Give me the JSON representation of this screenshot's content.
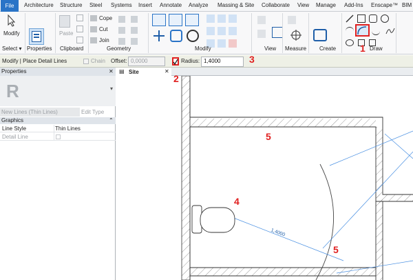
{
  "tabs": [
    "File",
    "Architecture",
    "Structure",
    "Steel",
    "Systems",
    "Insert",
    "Annotate",
    "Analyze",
    "Massing & Site",
    "Collaborate",
    "View",
    "Manage",
    "Add-Ins",
    "Enscape™",
    "BIM"
  ],
  "ribbon": {
    "modify_label": "Modify",
    "paste_label": "Paste",
    "cope_label": "Cope",
    "cut_label": "Cut",
    "join_label": "Join",
    "panels": [
      "Select ▾",
      "Properties",
      "Clipboard",
      "Geometry",
      "Modify",
      "View",
      "Measure",
      "Create",
      "Draw"
    ]
  },
  "options_bar": {
    "context_title": "Modify | Place Detail Lines",
    "chain_label": "Chain",
    "offset_label": "Offset:",
    "offset_value": "0,0000",
    "radius_label": "Radius:",
    "radius_value": "1,4000",
    "radius_checked": true
  },
  "properties": {
    "title": "Properties",
    "type_selector": "New Lines (Thin Lines)",
    "edit_type": "Edit Type",
    "section": "Graphics",
    "rows": [
      {
        "name": "Line Style",
        "value": "Thin Lines"
      },
      {
        "name": "Detail Line",
        "value": ""
      }
    ]
  },
  "view": {
    "tab_label": "Site",
    "dimension_text": "1,4000"
  },
  "callouts": {
    "one": "1",
    "two": "2",
    "three": "3",
    "four": "4",
    "five_top": "5",
    "five_bottom": "5"
  },
  "colors": {
    "accent": "#2a74c7",
    "callout": "#e02020",
    "ref_line": "#4a90e2"
  }
}
